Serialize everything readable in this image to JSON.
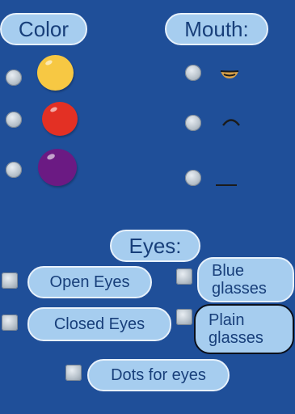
{
  "headers": {
    "color": "Color",
    "mouth": "Mouth:",
    "eyes": "Eyes:"
  },
  "color_options": [
    {
      "name": "yellow",
      "hex": "#f7c843"
    },
    {
      "name": "red",
      "hex": "#e33024"
    },
    {
      "name": "purple",
      "hex": "#6b1a83"
    }
  ],
  "mouth_options": [
    {
      "icon": "open-smile-mouth-icon"
    },
    {
      "icon": "frown-mouth-icon"
    },
    {
      "icon": "flat-line-mouth-icon"
    }
  ],
  "eye_options": {
    "open_eyes": "Open Eyes",
    "closed_eyes": "Closed Eyes",
    "dots_for_eyes": "Dots for eyes",
    "blue_glasses_line1": "Blue",
    "blue_glasses_line2": "glasses",
    "plain_glasses_line1": "Plain",
    "plain_glasses_line2": "glasses"
  },
  "colors": {
    "background": "#1f4f99",
    "pill_fill": "#a6cdef",
    "pill_text": "#183f7a"
  }
}
